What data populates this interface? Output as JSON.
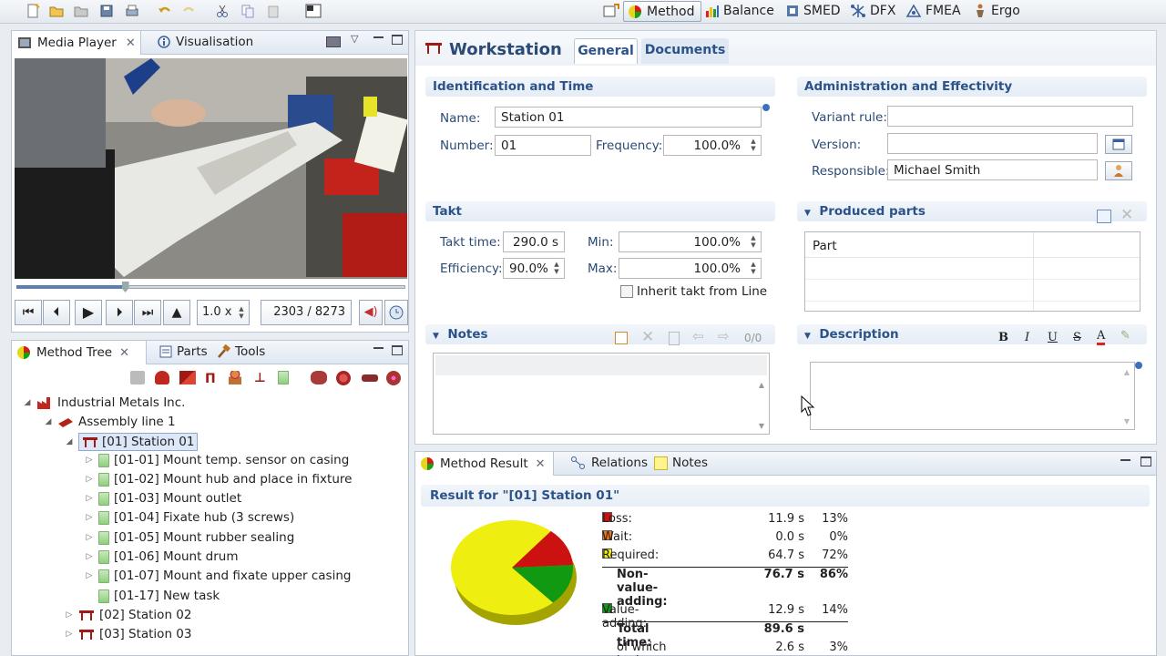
{
  "perspectives": [
    "Method",
    "Balance",
    "SMED",
    "DFX",
    "FMEA",
    "Ergo"
  ],
  "media": {
    "tab1": "Media Player",
    "tab2": "Visualisation",
    "speed": "1.0 x",
    "frame": "2303 / 8273",
    "progress": 0.28
  },
  "tree": {
    "tab1": "Method Tree",
    "tab2": "Parts",
    "tab3": "Tools",
    "root": "Industrial Metals Inc.",
    "line": "Assembly line 1",
    "station1": "[01] Station 01",
    "tasks": [
      "[01-01] Mount temp. sensor on casing",
      "[01-02] Mount hub and place in fixture",
      "[01-03] Mount outlet",
      "[01-04] Fixate hub (3 screws)",
      "[01-05] Mount rubber sealing",
      "[01-06] Mount drum",
      "[01-07] Mount and fixate upper casing",
      "[01-17] New task"
    ],
    "station2": "[02] Station 02",
    "station3": "[03] Station 03"
  },
  "editor": {
    "title": "Workstation",
    "tab_general": "General",
    "tab_documents": "Documents",
    "ident": {
      "header": "Identification and Time",
      "name_label": "Name:",
      "name": "Station 01",
      "number_label": "Number:",
      "number": "01",
      "freq_label": "Frequency:",
      "freq": "100.0%"
    },
    "takt": {
      "header": "Takt",
      "takt_label": "Takt time:",
      "takt": "290.0 s",
      "eff_label": "Efficiency:",
      "eff": "90.0%",
      "min_label": "Min:",
      "min": "100.0%",
      "max_label": "Max:",
      "max": "100.0%",
      "inherit": "Inherit takt from Line"
    },
    "notes": {
      "header": "Notes",
      "count": "0/0"
    },
    "admin": {
      "header": "Administration and Effectivity",
      "variant_label": "Variant rule:",
      "variant": "",
      "version_label": "Version:",
      "version": "",
      "resp_label": "Responsible:",
      "resp": "Michael Smith"
    },
    "parts": {
      "header": "Produced parts",
      "col": "Part"
    },
    "desc": {
      "header": "Description"
    }
  },
  "result": {
    "tab1": "Method Result",
    "tab2": "Relations",
    "tab3": "Notes",
    "title": "Result for \"[01] Station 01\"",
    "rows": [
      {
        "label": "Loss:",
        "time": "11.9 s",
        "pct": "13%",
        "color": "#cc1111"
      },
      {
        "label": "Wait:",
        "time": "0.0 s",
        "pct": "0%",
        "color": "#ee7711"
      },
      {
        "label": "Required:",
        "time": "64.7 s",
        "pct": "72%",
        "color": "#eeee11"
      },
      {
        "label": "Non-value-adding:",
        "time": "76.7 s",
        "pct": "86%",
        "color": ""
      },
      {
        "label": "Value-adding:",
        "time": "12.9 s",
        "pct": "14%",
        "color": "#119911"
      },
      {
        "label": "Total time:",
        "time": "89.6 s",
        "pct": "",
        "color": ""
      },
      {
        "label": "of which bad ergonomics:",
        "time": "2.6 s",
        "pct": "3%",
        "color": ""
      }
    ]
  }
}
